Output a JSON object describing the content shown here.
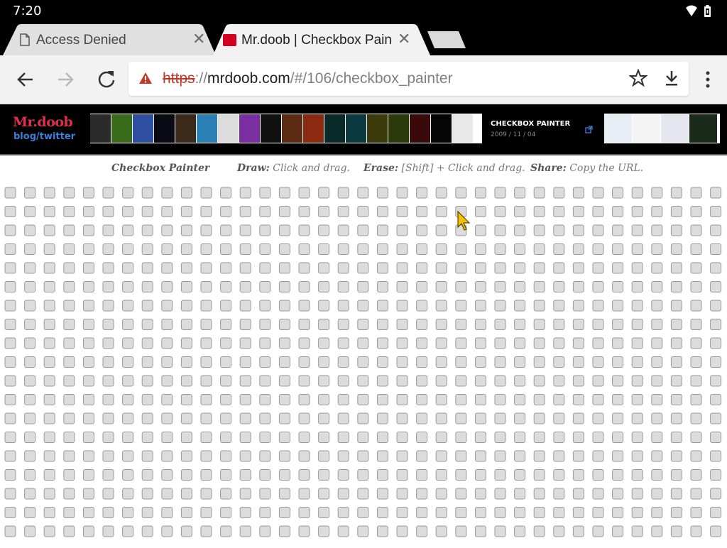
{
  "status_bar": {
    "time": "7:20"
  },
  "tabs": [
    {
      "title": "Access Denied",
      "active": false
    },
    {
      "title": "Mr.doob | Checkbox Painter",
      "active": true
    }
  ],
  "toolbar": {
    "url_scheme": "https",
    "url_separator": "://",
    "url_host": "mrdoob.com",
    "url_path": "/#/106/checkbox_painter"
  },
  "banner": {
    "logo_title": "Mr.doob",
    "logo_subtitle": "blog/twitter",
    "project_title": "CHECKBOX PAINTER",
    "project_date": "2009 / 11 / 04"
  },
  "instructions": {
    "app_name": "Checkbox Painter",
    "draw_label": "Draw:",
    "draw_text": "Click and drag.",
    "erase_label": "Erase:",
    "erase_text": "[Shift] + Click and drag.",
    "share_label": "Share:",
    "share_text": "Copy the URL."
  },
  "colors": {
    "accent_red": "#e0304e",
    "link_blue": "#3d7fdc",
    "checkbox_fill": "#dcdcdc",
    "checkbox_border": "#9a9a9a"
  }
}
